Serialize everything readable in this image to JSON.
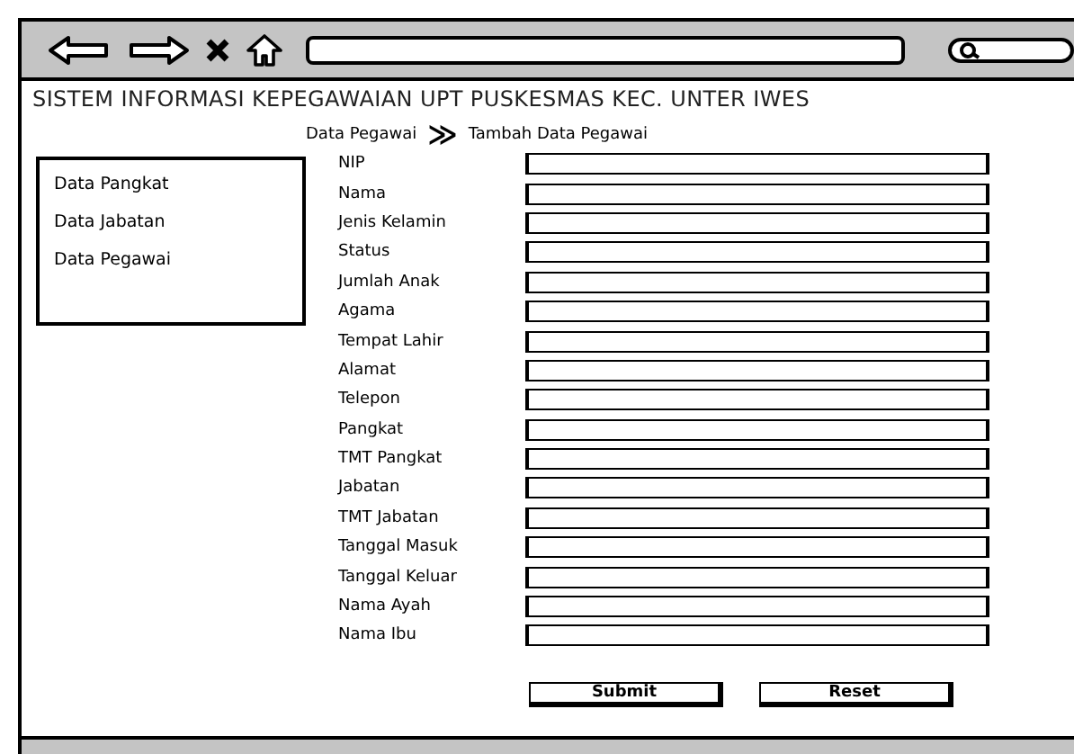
{
  "header": {
    "title": "SISTEM INFORMASI KEPEGAWAIAN UPT PUSKESMAS KEC. UNTER IWES"
  },
  "breadcrumb": [
    {
      "label": "Data Pegawai"
    },
    {
      "label": "≫",
      "kind": "separator"
    },
    {
      "label": "Tambah Data Pegawai"
    }
  ],
  "sidebar": {
    "items": [
      {
        "label": "Data Pangkat"
      },
      {
        "label": "Data Jabatan"
      },
      {
        "label": "Data Pegawai"
      }
    ]
  },
  "form": {
    "fields": [
      {
        "label": "NIP"
      },
      {
        "label": "Nama"
      },
      {
        "label": "Jenis Kelamin"
      },
      {
        "label": "Status"
      },
      {
        "label": "Jumlah Anak"
      },
      {
        "label": "Agama"
      },
      {
        "label": "Tempat Lahir"
      },
      {
        "label": "Alamat"
      },
      {
        "label": "Telepon"
      },
      {
        "label": "Pangkat"
      },
      {
        "label": "TMT Pangkat"
      },
      {
        "label": "Jabatan"
      },
      {
        "label": "TMT Jabatan"
      },
      {
        "label": "Tanggal Masuk"
      },
      {
        "label": "Tanggal Keluar"
      },
      {
        "label": "Nama Ayah"
      },
      {
        "label": "Nama Ibu"
      }
    ],
    "buttons": [
      "Submit",
      "Reset"
    ]
  }
}
